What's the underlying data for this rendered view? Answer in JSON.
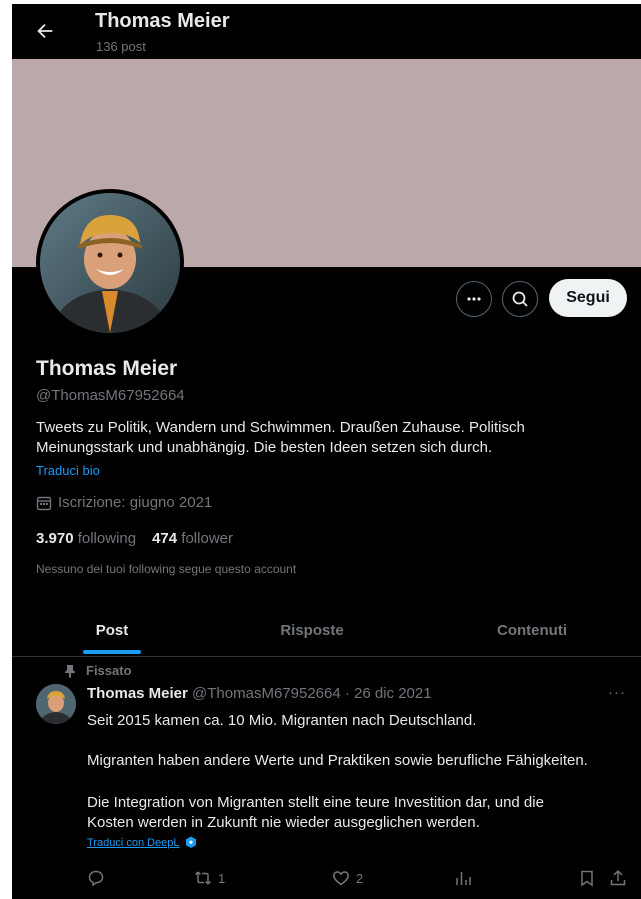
{
  "header": {
    "back_label": "←",
    "name": "Thomas Meier",
    "post_count": "136 post"
  },
  "profile": {
    "name": "Thomas Meier",
    "handle": "@ThomasM67952664",
    "bio_line1": "Tweets zu Politik, Wandern und Schwimmen. Draußen Zuhause. Politisch",
    "bio_line2": "Meinungsstark und unabhängig. Die besten Ideen setzen sich durch.",
    "translate_bio": "Traduci bio",
    "joined": "Iscrizione: giugno 2021",
    "following_count": "3.970",
    "following_label": "following",
    "followers_count": "474",
    "followers_label": "follower",
    "followers_note": "Nessuno dei tuoi following segue questo account",
    "follow_button": "Segui",
    "banner_color": "#baa9a8"
  },
  "tabs": [
    {
      "label": "Post",
      "active": true
    },
    {
      "label": "Risposte",
      "active": false
    },
    {
      "label": "Contenuti",
      "active": false
    }
  ],
  "tweet": {
    "pinned_label": "Fissato",
    "author": "Thomas Meier",
    "meta": "@ThomasM67952664 · 26 dic 2021",
    "lines": [
      "Seit 2015 kamen ca. 10 Mio. Migranten nach Deutschland.",
      "Migranten haben andere Werte und Praktiken sowie berufliche Fähigkeiten.",
      "Die Integration von Migranten stellt eine teure Investition dar, und die",
      "Kosten werden in Zukunft nie wieder ausgeglichen werden."
    ],
    "translate_label": "Traduci con DeepL",
    "retweets": "1",
    "likes": "2"
  },
  "colors": {
    "accent": "#1d9bf0",
    "background": "#000000",
    "muted": "#71767b"
  }
}
